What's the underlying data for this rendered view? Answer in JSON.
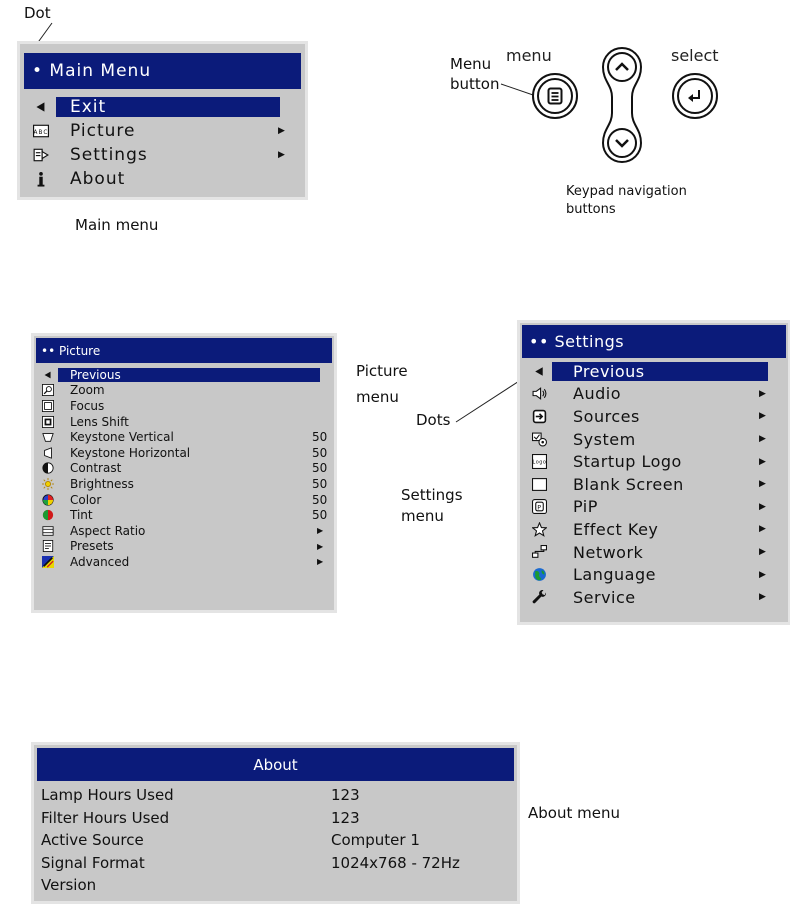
{
  "captions": {
    "dot": "Dot",
    "main_menu": "Main menu",
    "menu_button_line1": "Menu",
    "menu_button_line2": "button",
    "keypad_line1": "Keypad navigation",
    "keypad_line2": "buttons",
    "picture_menu_line1": "Picture",
    "picture_menu_line2": "menu",
    "dots": "Dots",
    "settings_menu_line1": "Settings",
    "settings_menu_line2": "menu",
    "about_menu": "About menu"
  },
  "keypad": {
    "menu_label": "menu",
    "select_label": "select"
  },
  "main_menu": {
    "title": "• Main Menu",
    "items": [
      {
        "label": "Exit",
        "icon": "back-arrow-icon",
        "selected": true
      },
      {
        "label": "Picture",
        "icon": "picture-icon",
        "submenu": true
      },
      {
        "label": "Settings",
        "icon": "settings-icon",
        "submenu": true
      },
      {
        "label": "About",
        "icon": "info-icon"
      }
    ]
  },
  "picture_menu": {
    "title": "•• Picture",
    "items": [
      {
        "label": "Previous",
        "icon": "back-arrow-icon",
        "selected": true,
        "value": ""
      },
      {
        "label": "Zoom",
        "icon": "zoom-icon",
        "value": ""
      },
      {
        "label": "Focus",
        "icon": "focus-icon",
        "value": ""
      },
      {
        "label": "Lens Shift",
        "icon": "lens-shift-icon",
        "value": ""
      },
      {
        "label": "Keystone Vertical",
        "icon": "keystone-vertical-icon",
        "value": "50"
      },
      {
        "label": "Keystone Horizontal",
        "icon": "keystone-horizontal-icon",
        "value": "50"
      },
      {
        "label": "Contrast",
        "icon": "contrast-icon",
        "value": "50"
      },
      {
        "label": "Brightness",
        "icon": "brightness-icon",
        "value": "50"
      },
      {
        "label": "Color",
        "icon": "color-icon",
        "value": "50"
      },
      {
        "label": "Tint",
        "icon": "tint-icon",
        "value": "50"
      },
      {
        "label": "Aspect Ratio",
        "icon": "aspect-ratio-icon",
        "submenu": true,
        "value": ""
      },
      {
        "label": "Presets",
        "icon": "presets-icon",
        "submenu": true,
        "value": ""
      },
      {
        "label": "Advanced",
        "icon": "advanced-icon",
        "submenu": true,
        "value": ""
      }
    ]
  },
  "settings_menu": {
    "title": "•• Settings",
    "items": [
      {
        "label": "Previous",
        "icon": "back-arrow-icon",
        "selected": true
      },
      {
        "label": "Audio",
        "icon": "speaker-icon",
        "submenu": true
      },
      {
        "label": "Sources",
        "icon": "sources-icon",
        "submenu": true
      },
      {
        "label": "System",
        "icon": "system-icon",
        "submenu": true
      },
      {
        "label": "Startup Logo",
        "icon": "logo-icon",
        "submenu": true
      },
      {
        "label": "Blank Screen",
        "icon": "blank-screen-icon",
        "submenu": true
      },
      {
        "label": "PiP",
        "icon": "pip-icon",
        "submenu": true
      },
      {
        "label": "Effect Key",
        "icon": "star-icon",
        "submenu": true
      },
      {
        "label": "Network",
        "icon": "network-icon",
        "submenu": true
      },
      {
        "label": "Language",
        "icon": "globe-icon",
        "submenu": true
      },
      {
        "label": "Service",
        "icon": "wrench-icon",
        "submenu": true
      }
    ]
  },
  "about_menu": {
    "title": "About",
    "rows": [
      {
        "key": "Lamp Hours Used",
        "value": "123"
      },
      {
        "key": "Filter Hours Used",
        "value": "123"
      },
      {
        "key": "Active Source",
        "value": "Computer 1"
      },
      {
        "key": "Signal Format",
        "value": "1024x768 - 72Hz"
      },
      {
        "key": "Version",
        "value": ""
      }
    ]
  },
  "colors": {
    "header_blue": "#0b1b7a",
    "panel_gray": "#c8c8c8"
  }
}
